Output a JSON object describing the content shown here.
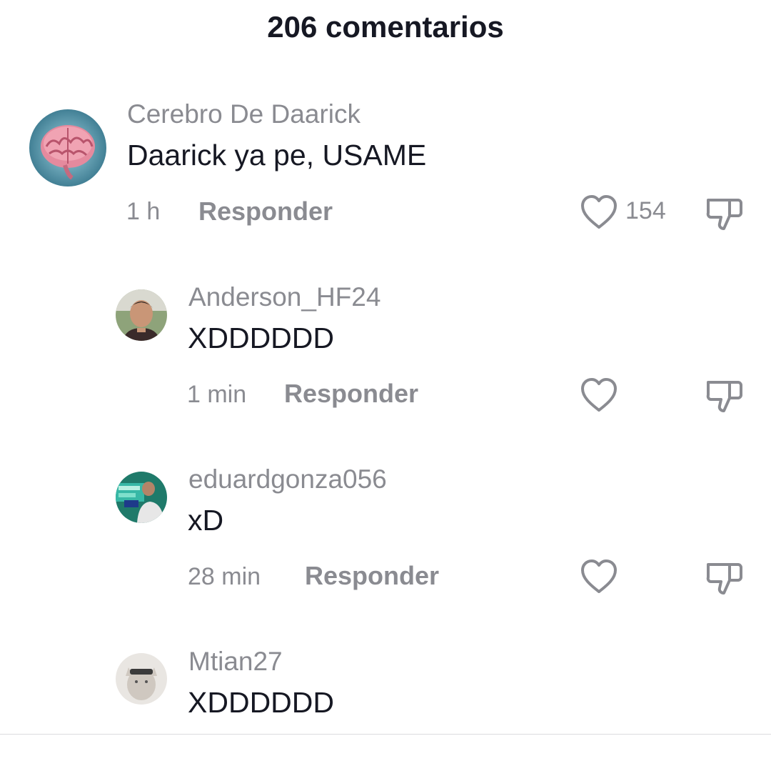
{
  "header": {
    "title": "206 comentarios"
  },
  "comments": [
    {
      "username": "Cerebro De Daarick",
      "text": "Daarick ya pe, USAME",
      "time": "1 h",
      "reply_label": "Responder",
      "like_count": "154",
      "avatar_icon": "brain-avatar"
    },
    {
      "username": "Anderson_HF24",
      "text": "XDDDDDD",
      "time": "1 min",
      "reply_label": "Responder",
      "avatar_icon": "person-avatar"
    },
    {
      "username": "eduardgonza056",
      "text": "xD",
      "time": "28 min",
      "reply_label": "Responder",
      "avatar_icon": "person-avatar"
    },
    {
      "username": "Mtian27",
      "text": "XDDDDDD",
      "avatar_icon": "cat-avatar"
    }
  ],
  "colors": {
    "text": "#161823",
    "muted": "#8a8b91",
    "divider": "#dcdcde"
  }
}
